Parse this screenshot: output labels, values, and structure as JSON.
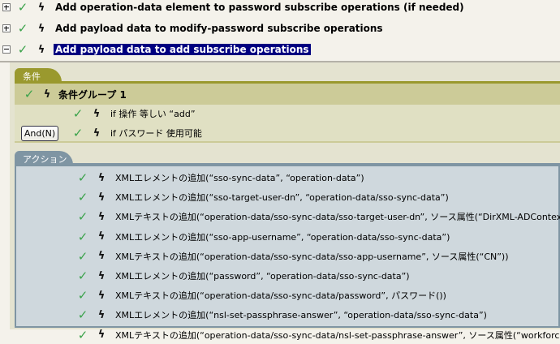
{
  "rules": [
    {
      "label": "Add operation-data element to password subscribe operations (if needed)",
      "expanded": false,
      "selected": false
    },
    {
      "label": "Add payload data to modify-password subscribe operations",
      "expanded": false,
      "selected": false
    },
    {
      "label": "Add payload data to add subscribe operations",
      "expanded": true,
      "selected": true
    }
  ],
  "conditions": {
    "tab_label": "条件",
    "group_label": "条件グループ 1",
    "and_button": "And(N)",
    "items": [
      "if 操作 等しい “add”",
      "if パスワード 使用可能"
    ]
  },
  "actions": {
    "tab_label": "アクション",
    "items": [
      "XMLエレメントの追加(“sso-sync-data”, “operation-data”)",
      "XMLエレメントの追加(“sso-target-user-dn”, “operation-data/sso-sync-data”)",
      "XMLテキストの追加(“operation-data/sso-sync-data/sso-target-user-dn”, ソース属性(“DirXML-ADContext”))",
      "XMLエレメントの追加(“sso-app-username”, “operation-data/sso-sync-data”)",
      "XMLテキストの追加(“operation-data/sso-sync-data/sso-app-username”, ソース属性(“CN”))",
      "XMLエレメントの追加(“password”, “operation-data/sso-sync-data”)",
      "XMLテキストの追加(“operation-data/sso-sync-data/password”, パスワード())",
      "XMLエレメントの追加(“nsl-set-passphrase-answer”, “operation-data/sso-sync-data”)",
      "XMLテキストの追加(“operation-data/sso-sync-data/nsl-set-passphrase-answer”, ソース属性(“workforceID”))"
    ]
  }
}
